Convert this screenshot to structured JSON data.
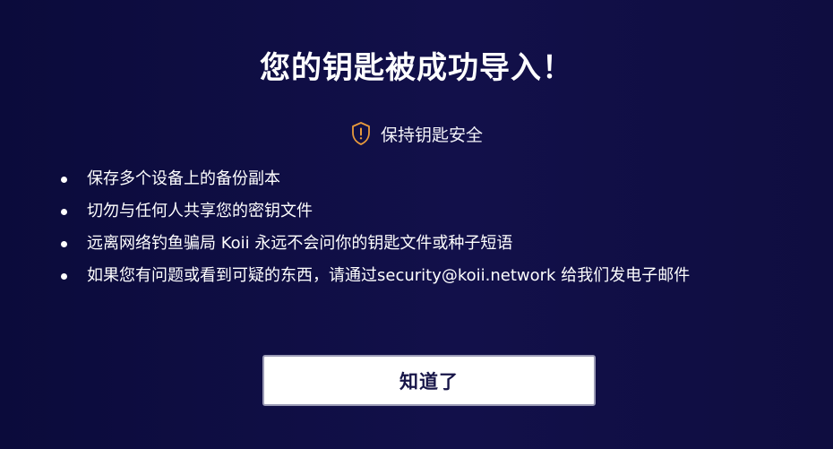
{
  "dialog": {
    "title": "您的钥匙被成功导入！",
    "safety_heading": "保持钥匙安全",
    "safety_icon": "shield-exclamation-icon",
    "accent_color": "#e89a3c",
    "tips": [
      "保存多个设备上的备份副本",
      "切勿与任何人共享您的密钥文件",
      "远离网络钓鱼骗局 Koii 永远不会问你的钥匙文件或种子短语",
      "如果您有问题或看到可疑的东西，请通过security@koii.network 给我们发电子邮件"
    ],
    "confirm_label": "知道了"
  }
}
